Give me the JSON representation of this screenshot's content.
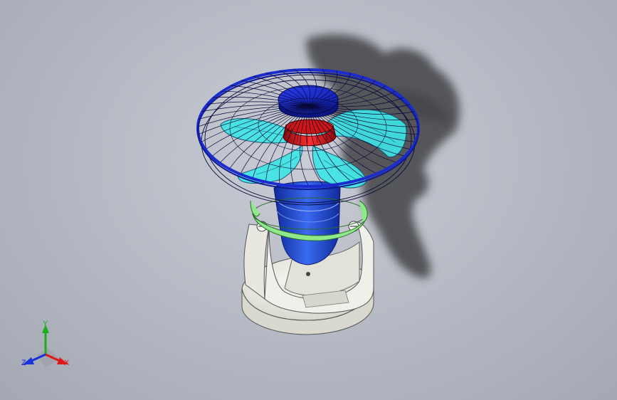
{
  "viewport": {
    "model": "desk-fan-assembly",
    "colors": {
      "background": "#b4b8c2",
      "guard": "#1a2bd0",
      "blades": "#3de6e6",
      "hub": "#e01a1a",
      "motor": "#1f45c8",
      "bracket": "#8fe88a",
      "base": "#ecece6",
      "shadow": "#3a3a3e"
    }
  },
  "triad": {
    "x_label": "X",
    "y_label": "Y",
    "z_label": "Z",
    "x_color": "#e01818",
    "y_color": "#18b018",
    "z_color": "#1830e0"
  }
}
